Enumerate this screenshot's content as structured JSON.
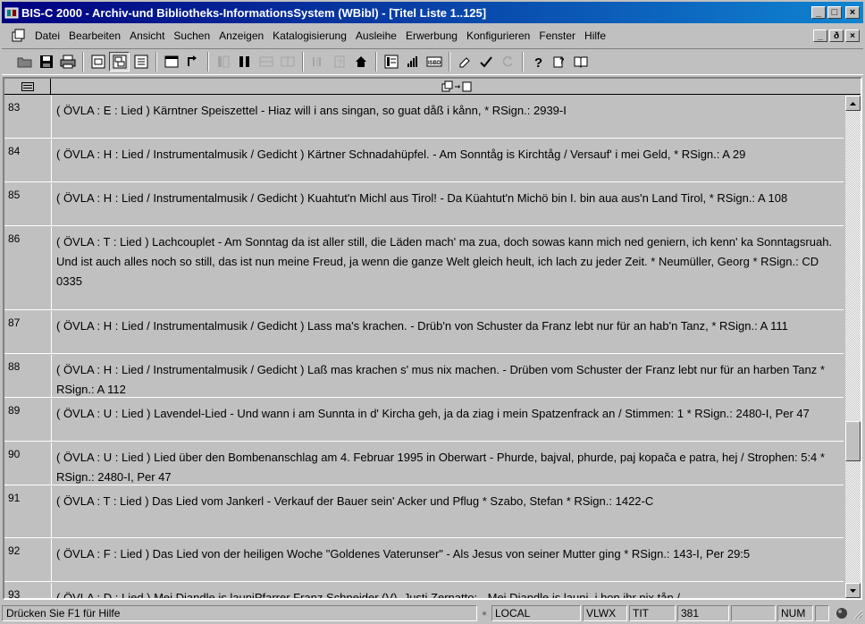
{
  "window": {
    "title": "BIS-C 2000 - Archiv-und Bibliotheks-InformationsSystem (WBibl) - [Titel Liste 1..125]",
    "controls": {
      "minimize": "_",
      "maximize": "□",
      "close": "×"
    }
  },
  "menu": [
    {
      "id": "datei",
      "label": "Datei"
    },
    {
      "id": "bearbeiten",
      "label": "Bearbeiten"
    },
    {
      "id": "ansicht",
      "label": "Ansicht"
    },
    {
      "id": "suchen",
      "label": "Suchen"
    },
    {
      "id": "anzeigen",
      "label": "Anzeigen"
    },
    {
      "id": "katalogisierung",
      "label": "Katalogisierung"
    },
    {
      "id": "ausleihe",
      "label": "Ausleihe"
    },
    {
      "id": "erwerbung",
      "label": "Erwerbung"
    },
    {
      "id": "konfigurieren",
      "label": "Konfigurieren"
    },
    {
      "id": "fenster",
      "label": "Fenster"
    },
    {
      "id": "hilfe",
      "label": "Hilfe"
    }
  ],
  "mdi_controls": {
    "minimize": "_",
    "restore": "ð",
    "close": "×"
  },
  "toolbar": {
    "icons": [
      "open-folder-icon",
      "save-icon",
      "print-icon",
      "view-single-icon",
      "view-double-icon",
      "view-list-icon",
      "window-icon",
      "link-icon",
      "insert-col-icon",
      "delete-col-icon",
      "table-left-icon",
      "table-right-icon",
      "barcode-icon",
      "help-book-icon",
      "home-icon",
      "list-icon",
      "chart-icon",
      "isbd-icon",
      "eraser-icon",
      "checkmark-icon",
      "refresh-icon",
      "question-icon",
      "context-help-icon",
      "book-icon"
    ]
  },
  "grid": {
    "header_right_icon": "copy-to-new-icon",
    "rows": [
      {
        "num": "83",
        "text": "( ÖVLA : E : Lied ) Kärntner Speiszettel - Hiaz will i ans singan, so guat dåß i kånn, * RSign.: 2939-I"
      },
      {
        "num": "84",
        "text": "( ÖVLA : H : Lied / Instrumentalmusik / Gedicht ) Kärtner Schnadahüpfel. - Am Sonntåg is Kirchtåg / Versauf' i mei Geld, * RSign.: A 29"
      },
      {
        "num": "85",
        "text": "( ÖVLA : H : Lied / Instrumentalmusik / Gedicht ) Kuahtut'n Michl aus Tirol! - Da Küahtut'n Michö bin I. bin aua aus'n Land Tirol, * RSign.: A 108"
      },
      {
        "num": "86",
        "text": "( ÖVLA : T : Lied ) Lachcouplet - Am Sonntag da ist aller still, die Läden mach' ma zua, doch sowas kann mich ned geniern, ich kenn' ka Sonntagsruah. Und ist auch alles noch so still, das ist nun meine Freud, ja wenn die ganze Welt gleich heult, ich lach zu jeder Zeit. * Neumüller, Georg * RSign.: CD 0335"
      },
      {
        "num": "87",
        "text": "( ÖVLA : H : Lied / Instrumentalmusik / Gedicht ) Lass ma's krachen. - Drüb'n von Schuster da Franz lebt nur für an hab'n Tanz, * RSign.: A 111"
      },
      {
        "num": "88",
        "text": "( ÖVLA : H : Lied / Instrumentalmusik / Gedicht ) Laß mas krachen s' mus nix machen. - Drüben vom Schuster der Franz lebt nur für an harben Tanz * RSign.: A 112"
      },
      {
        "num": "89",
        "text": "( ÖVLA : U : Lied ) Lavendel-Lied - Und wann i am Sunnta in d' Kircha geh, ja da ziag i mein Spatzenfrack an / Stimmen: 1 * RSign.: 2480-I, Per 47"
      },
      {
        "num": "90",
        "text": "( ÖVLA : U : Lied ) Lied über den Bombenanschlag am 4. Februar 1995 in Oberwart - Phurde, bajval, phurde, paj kopača e patra, hej / Strophen: 5:4 * RSign.: 2480-I, Per 47"
      },
      {
        "num": "91",
        "text": "( ÖVLA : T : Lied ) Das Lied vom Jankerl - Verkauf der Bauer sein' Acker und Pflug * Szabo, Stefan * RSign.: 1422-C"
      },
      {
        "num": "92",
        "text": "( ÖVLA : F : Lied ) Das Lied von der heiligen Woche \"Goldenes Vaterunser\" - Als Jesus von seiner Mutter ging * RSign.: 143-I, Per 29:5"
      },
      {
        "num": "93",
        "text": "( ÖVLA : D : Lied ) Mei Diandle is launiPfarrer Franz Schneider (V), Justi Zernatto: - Mei Diandle is launi, i hon ihr nix tån /"
      }
    ],
    "scroll_position": 0.66
  },
  "status": {
    "help_text": "Drücken Sie F1 für Hilfe",
    "panes": [
      "LOCAL",
      "VLWX",
      "TIT",
      "381",
      "",
      "NUM",
      ""
    ],
    "indicator_dot": "●"
  },
  "colors": {
    "title_start": "#000080",
    "title_end": "#1084d0",
    "face": "#c0c0c0"
  }
}
